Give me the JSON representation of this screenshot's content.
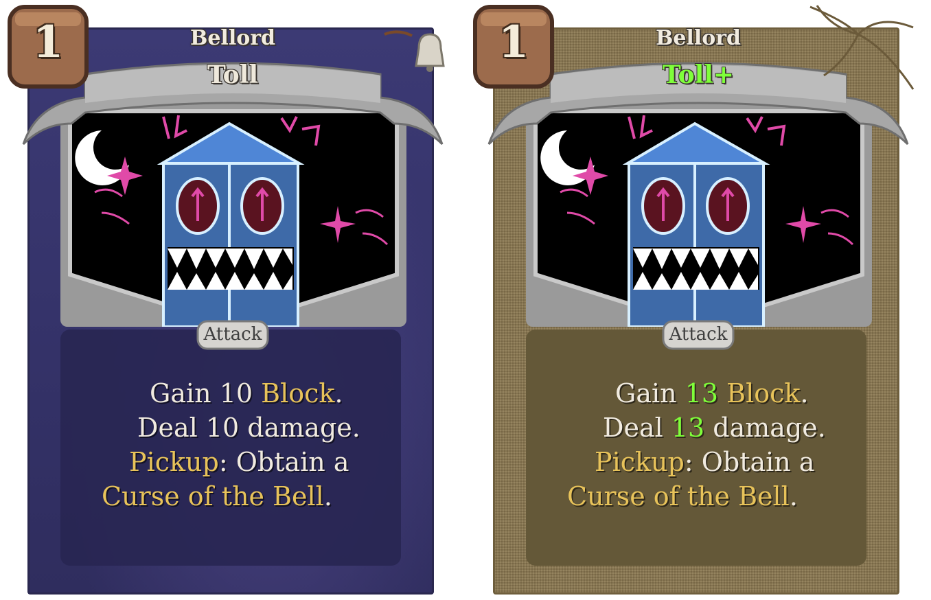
{
  "cards": [
    {
      "energy_cost": "1",
      "class_name": "Bellord",
      "name": "Toll",
      "type": "Attack",
      "description": {
        "line1": {
          "a": "Gain ",
          "value": "10",
          "b": " ",
          "kw": "Block",
          "c": "."
        },
        "line2": {
          "a": "Deal ",
          "value": "10",
          "b": " damage."
        },
        "line3": {
          "kw": "Pickup",
          "rest": ": Obtain a"
        },
        "line4": {
          "kw": "Curse of the Bell",
          "rest": "."
        }
      }
    },
    {
      "energy_cost": "1",
      "class_name": "Bellord",
      "name": "Toll+",
      "type": "Attack",
      "description": {
        "line1": {
          "a": "Gain ",
          "value": "13",
          "b": " ",
          "kw": "Block",
          "c": "."
        },
        "line2": {
          "a": "Deal ",
          "value": "13",
          "b": " damage."
        },
        "line3": {
          "kw": "Pickup",
          "rest": ": Obtain a"
        },
        "line4": {
          "kw": "Curse of the Bell",
          "rest": "."
        }
      }
    }
  ],
  "colors": {
    "keyword": "#e8c35a",
    "upgrade": "#7fff3a",
    "left_card_bg": "#3c3a74",
    "right_card_bg": "#8d7a52"
  },
  "icons": [
    "bell-ornament-icon",
    "twine-bow-icon",
    "energy-badge-icon"
  ]
}
